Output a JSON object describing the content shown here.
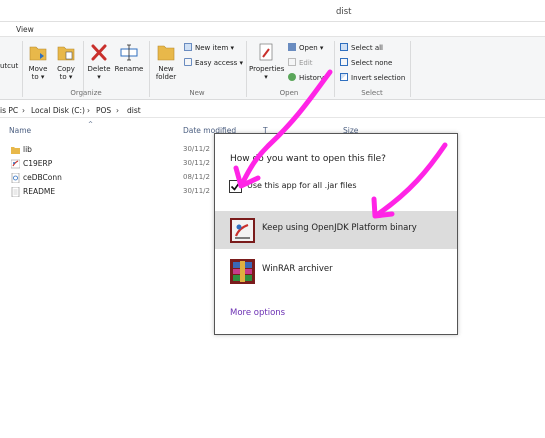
{
  "window": {
    "title": "dist"
  },
  "ribbon": {
    "tab_view": "View",
    "clipboard_partial": "utcut",
    "move_to": [
      "Move",
      "to ▾"
    ],
    "copy_to": [
      "Copy",
      "to ▾"
    ],
    "delete": [
      "Delete",
      "▾"
    ],
    "rename": "Rename",
    "new_folder": [
      "New",
      "folder"
    ],
    "new_item": "New item ▾",
    "easy_access": "Easy access ▾",
    "properties": [
      "Properties",
      "▾"
    ],
    "open": "Open ▾",
    "edit": "Edit",
    "history": "History",
    "select_all": "Select all",
    "select_none": "Select none",
    "invert_selection": "Invert selection",
    "groups": {
      "organize": "Organize",
      "new": "New",
      "open": "Open",
      "select": "Select"
    }
  },
  "address": {
    "crumbs": [
      "is PC",
      "›",
      "Local Disk (C:)",
      "›",
      "POS",
      "›",
      "dist"
    ]
  },
  "columns": {
    "name": "Name",
    "date": "Date modified",
    "type_partial": "T",
    "size": "Size"
  },
  "files": [
    {
      "name": "lib",
      "date": "30/11/2",
      "icon": "folder-icon"
    },
    {
      "name": "C19ERP",
      "date": "30/11/2",
      "icon": "jar-icon"
    },
    {
      "name": "ceDBConn",
      "date": "08/11/2",
      "icon": "file-icon"
    },
    {
      "name": "README",
      "date": "30/11/2",
      "icon": "text-file-icon"
    }
  ],
  "dialog": {
    "question": "How do you want to open this file?",
    "checkbox_label": "Use this app for all .jar files",
    "checkbox_checked": true,
    "options": [
      {
        "label": "Keep using OpenJDK Platform binary",
        "icon": "java-icon",
        "selected": true
      },
      {
        "label": "WinRAR archiver",
        "icon": "winrar-icon",
        "selected": false
      }
    ],
    "more_options": "More options"
  },
  "colors": {
    "annotation": "#ff24e6",
    "link": "#6b2fb3",
    "selected_option": "#dcdcdc",
    "folder": "#e8b84a"
  }
}
